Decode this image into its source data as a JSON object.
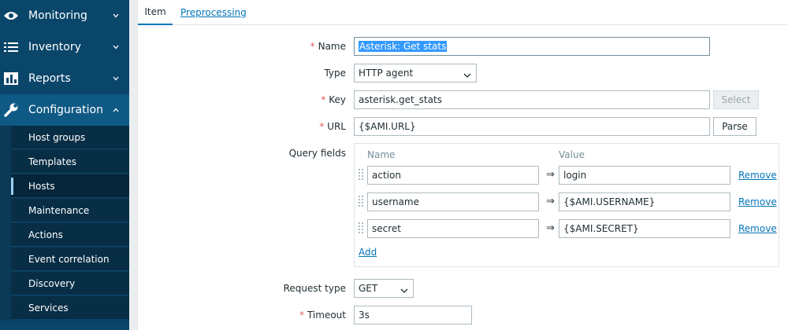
{
  "sidebar": {
    "menu": [
      {
        "label": "Monitoring",
        "icon": "eye-icon",
        "expanded": false
      },
      {
        "label": "Inventory",
        "icon": "list-icon",
        "expanded": false
      },
      {
        "label": "Reports",
        "icon": "bar-chart-icon",
        "expanded": false
      },
      {
        "label": "Configuration",
        "icon": "wrench-icon",
        "expanded": true
      }
    ],
    "submenu": [
      {
        "label": "Host groups"
      },
      {
        "label": "Templates"
      },
      {
        "label": "Hosts",
        "selected": true
      },
      {
        "label": "Maintenance"
      },
      {
        "label": "Actions"
      },
      {
        "label": "Event correlation"
      },
      {
        "label": "Discovery"
      },
      {
        "label": "Services"
      }
    ]
  },
  "tabs": [
    {
      "label": "Item",
      "active": true
    },
    {
      "label": "Preprocessing",
      "active": false
    }
  ],
  "form": {
    "name": {
      "label": "Name",
      "value": "Asterisk: Get stats"
    },
    "type": {
      "label": "Type",
      "value": "HTTP agent"
    },
    "key": {
      "label": "Key",
      "value": "asterisk.get_stats",
      "button": "Select"
    },
    "url": {
      "label": "URL",
      "value": "{$AMI.URL}",
      "button": "Parse"
    },
    "query_fields": {
      "label": "Query fields",
      "col_name": "Name",
      "col_value": "Value",
      "arrow": "⇒",
      "remove": "Remove",
      "add": "Add",
      "rows": [
        {
          "name": "action",
          "value": "login"
        },
        {
          "name": "username",
          "value": "{$AMI.USERNAME}"
        },
        {
          "name": "secret",
          "value": "{$AMI.SECRET}"
        }
      ]
    },
    "request_type": {
      "label": "Request type",
      "value": "GET"
    },
    "timeout": {
      "label": "Timeout",
      "value": "3s"
    }
  },
  "colors": {
    "accent": "#0275b8",
    "sidebar": "#0a466a",
    "required": "#e45959"
  }
}
